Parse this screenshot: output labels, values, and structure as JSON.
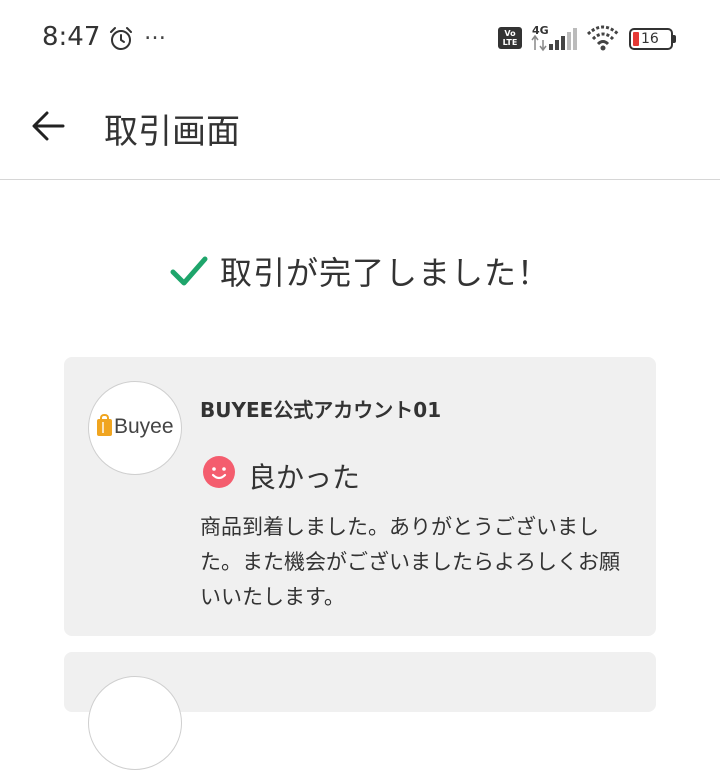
{
  "status_bar": {
    "time": "8:47",
    "more": "…",
    "volte": "Vo LTE",
    "network_type": "4G",
    "battery_level": "16",
    "battery_color": "#e53935"
  },
  "app_bar": {
    "back_icon": "arrow-left",
    "title": "取引画面"
  },
  "completion": {
    "icon": "check-icon",
    "icon_color": "#1ea56b",
    "message": "取引が完了しました！"
  },
  "review": {
    "avatar_logo": "Buyee",
    "logo_color": "#f0a520",
    "seller_name": "BUYEE公式アカウント01",
    "rating_icon": "smile-face-icon",
    "rating_icon_color": "#f45d6e",
    "rating_label": "良かった",
    "message": "商品到着しました。ありがとうございました。また機会がございましたらよろしくお願いいたします。"
  }
}
